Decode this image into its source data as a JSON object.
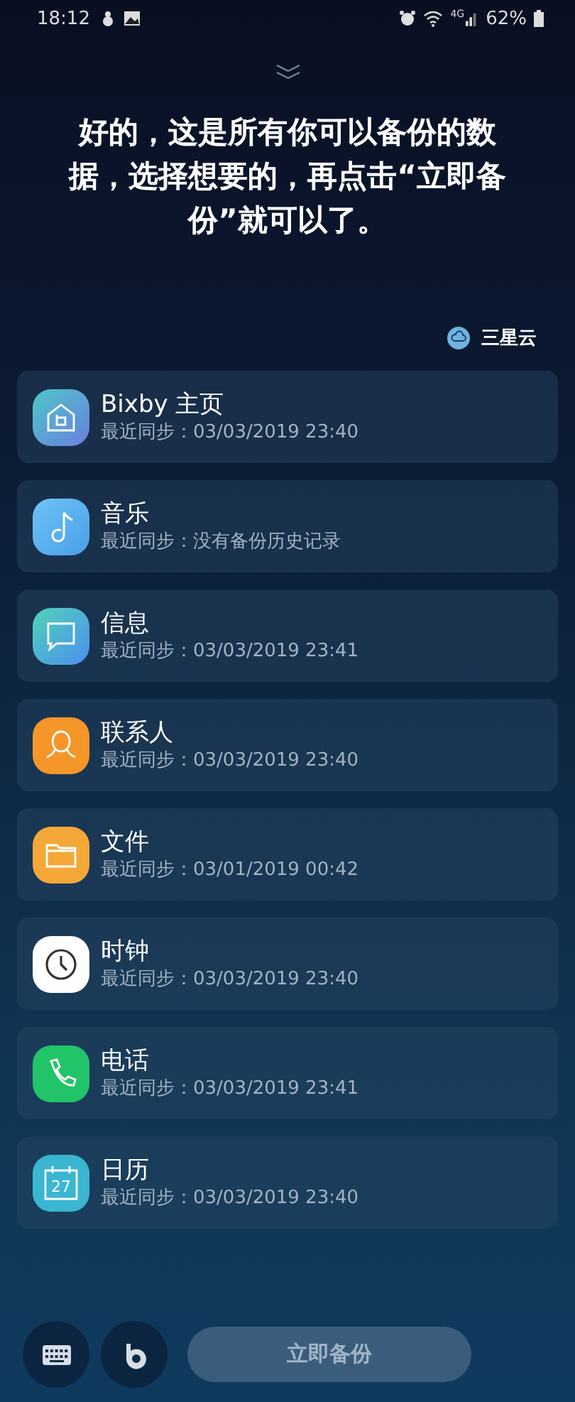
{
  "status_bar": {
    "time": "18:12",
    "network": "4G",
    "battery": "62%"
  },
  "prompt": "好的，这是所有你可以备份的数据，选择想要的，再点击“立即备份”就可以了。",
  "account": {
    "label": "三星云"
  },
  "items": [
    {
      "kind": "home",
      "title": "Bixby 主页",
      "subtitle": "最近同步：03/03/2019 23:40"
    },
    {
      "kind": "music",
      "title": "音乐",
      "subtitle": "最近同步：没有备份历史记录"
    },
    {
      "kind": "message",
      "title": "信息",
      "subtitle": "最近同步：03/03/2019 23:41"
    },
    {
      "kind": "contact",
      "title": "联系人",
      "subtitle": "最近同步：03/03/2019 23:40"
    },
    {
      "kind": "folder",
      "title": "文件",
      "subtitle": "最近同步：03/01/2019 00:42"
    },
    {
      "kind": "clock",
      "title": "时钟",
      "subtitle": "最近同步：03/03/2019 23:40"
    },
    {
      "kind": "phone",
      "title": "电话",
      "subtitle": "最近同步：03/03/2019 23:41"
    },
    {
      "kind": "calendar",
      "title": "日历",
      "subtitle": "最近同步：03/03/2019 23:40",
      "icon_text": "27"
    }
  ],
  "backup_button": {
    "label": "立即备份",
    "disabled": true
  }
}
